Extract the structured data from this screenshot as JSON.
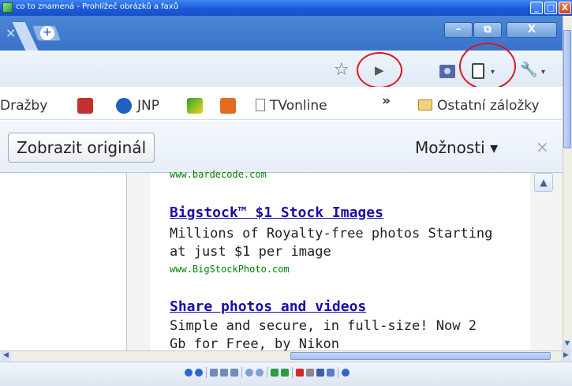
{
  "window": {
    "title": "co to znamená - Prohlížeč obrázků a faxů",
    "minimize_glyph": "_",
    "maximize_glyph": "□",
    "close_glyph": "X"
  },
  "browser": {
    "tab_close_glyph": "×",
    "newtab_glyph": "+",
    "inner_min_glyph": "–",
    "inner_restore_glyph": "⧉",
    "inner_close_glyph": "X"
  },
  "toolbar": {
    "star_glyph": "☆",
    "play_glyph": "▶",
    "wrench_glyph": "🔧",
    "chevron_glyph": "▾"
  },
  "bookmarks": {
    "items": [
      {
        "label": "Dražby",
        "icon": "auction-icon"
      },
      {
        "label": "",
        "icon": "youtube-icon"
      },
      {
        "label": "JNP",
        "icon": "help-icon"
      },
      {
        "label": "",
        "icon": "game-icon"
      },
      {
        "label": "",
        "icon": "zoner-icon"
      },
      {
        "label": "TVonline",
        "icon": "page-icon"
      }
    ],
    "overflow_glyph": "»",
    "other_label": "Ostatní záložky"
  },
  "translate_bar": {
    "show_original": "Zobrazit originál",
    "options": "Možnosti ▾",
    "close_glyph": "×"
  },
  "page": {
    "ads": [
      {
        "url_top": "www.bardecode.com"
      },
      {
        "title": "Bigstock™ $1 Stock Images",
        "line1": "Millions of Royalty-free photos Starting",
        "line2": "at just $1 per image",
        "url": "www.BigStockPhoto.com"
      },
      {
        "title": "Share photos and videos",
        "line1": "Simple and secure, in full-size! Now 2",
        "line2": "Gb for Free, by Nikon"
      }
    ]
  },
  "colors": {
    "annotation_circle": "#e0151b",
    "link": "#1a0dab",
    "url": "#008000"
  }
}
